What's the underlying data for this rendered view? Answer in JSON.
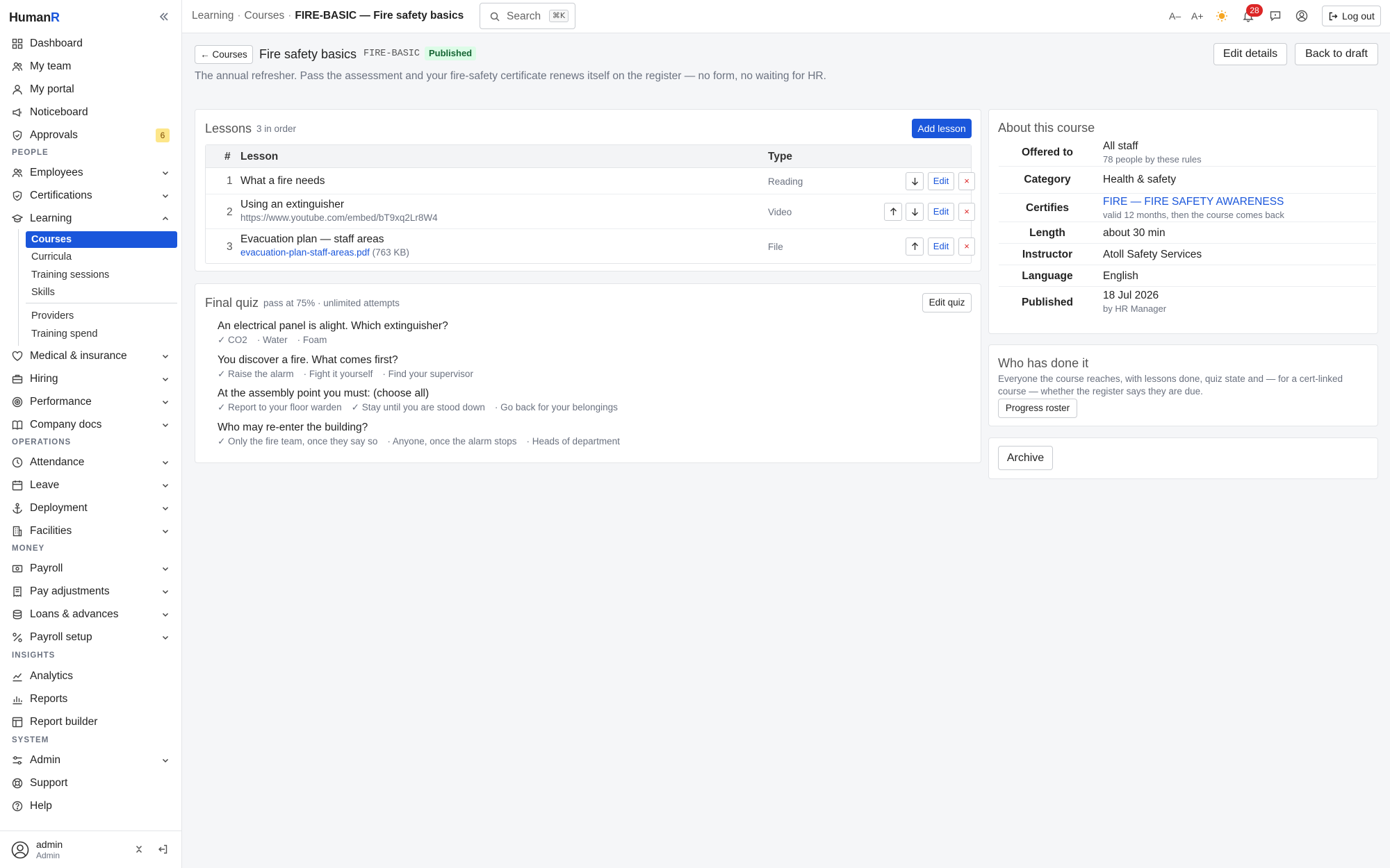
{
  "app": {
    "brand_main": "Human",
    "brand_accent": "R"
  },
  "sidebar": {
    "items": [
      {
        "label": "Dashboard",
        "icon": "grid-icon"
      },
      {
        "label": "My team",
        "icon": "team-icon"
      },
      {
        "label": "My portal",
        "icon": "user-icon"
      },
      {
        "label": "Noticeboard",
        "icon": "megaphone-icon"
      },
      {
        "label": "Approvals",
        "icon": "shield-check-icon",
        "badge": "6"
      }
    ],
    "sections": {
      "people": "PEOPLE",
      "operations": "OPERATIONS",
      "money": "MONEY",
      "insights": "INSIGHTS",
      "system": "SYSTEM"
    },
    "people_items": [
      "Employees",
      "Certifications",
      "Learning"
    ],
    "learning_sub": [
      "Courses",
      "Curricula",
      "Training sessions",
      "Skills",
      "Providers",
      "Training spend"
    ],
    "people_items2": [
      "Medical & insurance",
      "Hiring",
      "Performance",
      "Company docs"
    ],
    "operations_items": [
      "Attendance",
      "Leave",
      "Deployment",
      "Facilities"
    ],
    "money_items": [
      "Payroll",
      "Pay adjustments",
      "Loans & advances",
      "Payroll setup"
    ],
    "insights_items": [
      "Analytics",
      "Reports",
      "Report builder"
    ],
    "system_items": [
      "Admin",
      "Support",
      "Help"
    ],
    "user": {
      "name": "admin",
      "role": "Admin"
    }
  },
  "topbar": {
    "crumbs": [
      "Learning",
      "Courses",
      "FIRE-BASIC — Fire safety basics"
    ],
    "search_label": "Search",
    "search_kbd": "⌘K",
    "font_smaller": "A–",
    "font_larger": "A+",
    "notif_count": "28",
    "logout": "Log out"
  },
  "course": {
    "back": "← Courses",
    "title": "Fire safety basics",
    "code": "FIRE-BASIC",
    "status": "Published",
    "description": "The annual refresher. Pass the assessment and your fire-safety certificate renews itself on the register — no form, no waiting for HR.",
    "edit_details": "Edit details",
    "back_to_draft": "Back to draft"
  },
  "lessons": {
    "title": "Lessons",
    "subtitle": "3 in order",
    "add": "Add lesson",
    "col_num": "#",
    "col_lesson": "Lesson",
    "col_type": "Type",
    "edit": "Edit",
    "delete": "×",
    "rows": [
      {
        "num": "1",
        "title": "What a fire needs",
        "type": "Reading"
      },
      {
        "num": "2",
        "title": "Using an extinguisher",
        "url": "https://www.youtube.com/embed/bT9xq2Lr8W4",
        "type": "Video"
      },
      {
        "num": "3",
        "title": "Evacuation plan — staff areas",
        "file": "evacuation-plan-staff-areas.pdf",
        "size": " (763 KB)",
        "type": "File"
      }
    ]
  },
  "quiz": {
    "title": "Final quiz",
    "subtitle": "pass at 75% · unlimited attempts",
    "edit": "Edit quiz",
    "questions": [
      {
        "q": "An electrical panel is alight. Which extinguisher?",
        "opts": [
          "✓ CO2",
          "· Water",
          "· Foam"
        ]
      },
      {
        "q": "You discover a fire. What comes first?",
        "opts": [
          "✓ Raise the alarm",
          "· Fight it yourself",
          "· Find your supervisor"
        ]
      },
      {
        "q": "At the assembly point you must: (choose all)",
        "opts": [
          "✓ Report to your floor warden",
          "✓ Stay until you are stood down",
          "· Go back for your belongings"
        ]
      },
      {
        "q": "Who may re-enter the building?",
        "opts": [
          "✓ Only the fire team, once they say so",
          "· Anyone, once the alarm stops",
          "· Heads of department"
        ]
      }
    ]
  },
  "about": {
    "title": "About this course",
    "rows": [
      {
        "k": "Offered to",
        "v": "All staff",
        "v2": "78 people by these rules"
      },
      {
        "k": "Category",
        "v": "Health & safety"
      },
      {
        "k": "Certifies",
        "v": "FIRE — FIRE SAFETY AWARENESS",
        "v2": "valid 12 months, then the course comes back"
      },
      {
        "k": "Length",
        "v": "about 30 min"
      },
      {
        "k": "Instructor",
        "v": "Atoll Safety Services"
      },
      {
        "k": "Language",
        "v": "English"
      },
      {
        "k": "Published",
        "v": "18 Jul 2026",
        "v2": "by HR Manager"
      }
    ]
  },
  "who": {
    "title": "Who has done it",
    "desc": "Everyone the course reaches, with lessons done, quiz state and — for a cert-linked course — whether the register says they are due.",
    "btn": "Progress roster"
  },
  "archive": {
    "btn": "Archive"
  },
  "colors": {
    "accent": "#1a56db",
    "danger": "#dc2626",
    "success_bg": "#dcfce7",
    "success_fg": "#166534",
    "badge_bg": "#fde68a"
  }
}
